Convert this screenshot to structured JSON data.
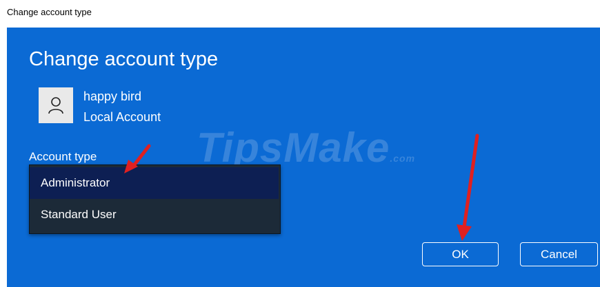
{
  "window": {
    "title": "Change account type"
  },
  "dialog": {
    "heading": "Change account type",
    "user": {
      "name": "happy bird",
      "account_kind": "Local Account",
      "avatar_icon": "user-icon"
    },
    "account_type_label": "Account type",
    "dropdown": {
      "options": [
        "Administrator",
        "Standard User"
      ],
      "selected": "Administrator"
    },
    "buttons": {
      "ok": "OK",
      "cancel": "Cancel"
    }
  },
  "watermark": {
    "brand": "TipsMake",
    "suffix": ".com"
  },
  "annotation": {
    "arrow_color": "#e02020"
  },
  "colors": {
    "accent": "#0b6ad4",
    "dropdown_bg": "#1c2a38",
    "selected_bg": "#0d1f53"
  }
}
